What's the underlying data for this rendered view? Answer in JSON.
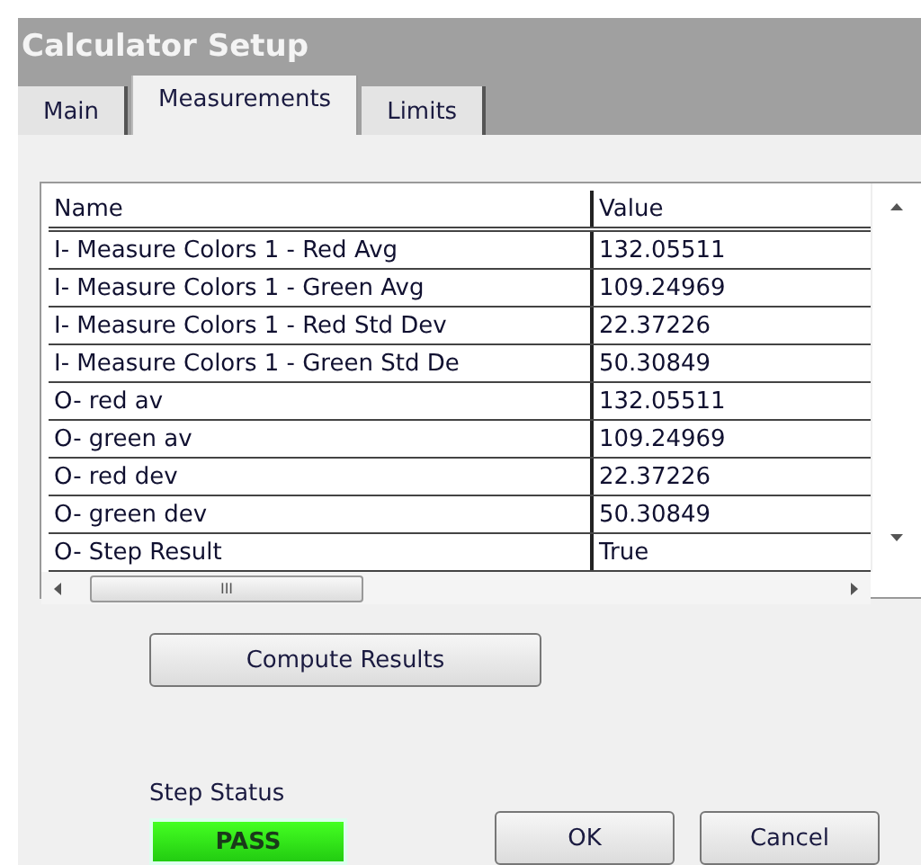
{
  "window": {
    "title": "Calculator Setup"
  },
  "tabs": [
    {
      "label": "Main",
      "selected": false
    },
    {
      "label": "Measurements",
      "selected": true
    },
    {
      "label": "Limits",
      "selected": false
    }
  ],
  "table": {
    "columns": [
      "Name",
      "Value"
    ],
    "rows": [
      [
        "I- Measure Colors 1 - Red Avg",
        "132.05511"
      ],
      [
        "I- Measure Colors 1 - Green Avg",
        "109.24969"
      ],
      [
        "I- Measure Colors 1 - Red Std Dev",
        "22.37226"
      ],
      [
        "I- Measure Colors 1 - Green Std De",
        "50.30849"
      ],
      [
        "O- red av",
        "132.05511"
      ],
      [
        "O- green av",
        "109.24969"
      ],
      [
        "O- red dev",
        "22.37226"
      ],
      [
        "O- green dev",
        "50.30849"
      ],
      [
        "O- Step Result",
        "True"
      ]
    ],
    "scroll_grip": "III"
  },
  "compute_button": "Compute Results",
  "step_status": {
    "label": "Step Status",
    "value": "PASS"
  },
  "buttons": [
    "OK",
    "Cancel"
  ]
}
